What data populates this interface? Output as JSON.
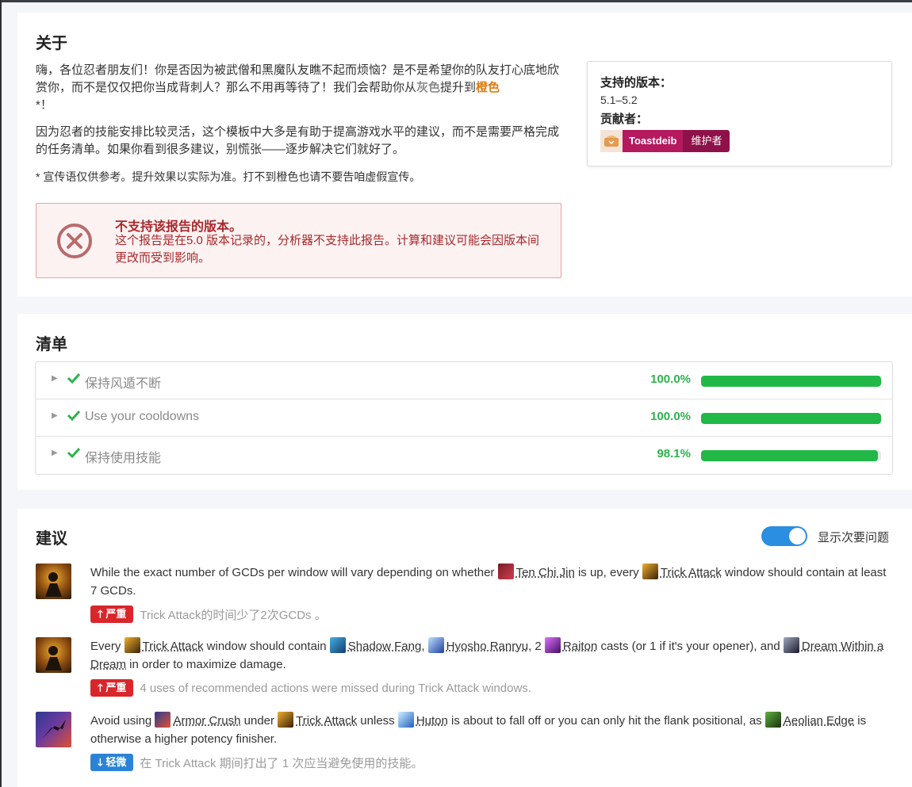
{
  "about": {
    "title": "关于",
    "p1_a": "嗨，各位忍者朋友们！你是否因为被武僧和黑魔队友瞧不起而烦恼？是不是希望你的队友打心底地欣赏你，而不是仅仅把你当成背刺人？那么不用再等待了！我们会帮助你从",
    "p1_gray": "灰色",
    "p1_mid": "提升到",
    "p1_orange": "橙色",
    "p1_end": "*！",
    "p2": "因为忍者的技能安排比较灵活，这个模板中大多是有助于提高游戏水平的建议，而不是需要严格完成的任务清单。如果你看到很多建议，别慌张——逐步解决它们就好了。",
    "p3": "* 宣传语仅供参考。提升效果以实际为准。打不到橙色也请不要告咱虚假宣传。",
    "error_title": "不支持该报告的版本。",
    "error_desc": "这个报告是在5.0 版本记录的，分析器不支持此报告。计算和建议可能会因版本间更改而受到影响。",
    "versions_label": "支持的版本：",
    "versions_value": "5.1–5.2",
    "contributors_label": "贡献者：",
    "contributor_name": "Toastdeib",
    "contributor_role": "维护者"
  },
  "checklist": {
    "title": "清单",
    "items": [
      {
        "label": "保持风遁不断",
        "percent": "100.0%",
        "value": 1.0
      },
      {
        "label": "Use your cooldowns",
        "percent": "100.0%",
        "value": 1.0
      },
      {
        "label": "保持使用技能",
        "percent": "98.1%",
        "value": 0.981
      }
    ]
  },
  "suggestions": {
    "title": "建议",
    "toggle_label": "显示次要问题",
    "toggle_on": true,
    "s1": {
      "t1": "While the exact number of GCDs per window will vary depending on whether ",
      "spell1": "Ten Chi Jin",
      "t2": " is up, every ",
      "spell2": "Trick Attack",
      "t3": " window should contain at least 7 GCDs.",
      "severity": "严重",
      "detail": "Trick Attack的时间少了2次GCDs 。"
    },
    "s2": {
      "t1": "Every ",
      "spell1": "Trick Attack",
      "t2": " window should contain ",
      "spell2": "Shadow Fang",
      "t3": ", ",
      "spell3": "Hyosho Ranryu",
      "t4": ", 2 ",
      "spell4": "Raiton",
      "t5": " casts (or 1 if it's your opener), and ",
      "spell5": "Dream Within a Dream",
      "t6": " in order to maximize damage.",
      "severity": "严重",
      "detail": "4 uses of recommended actions were missed during Trick Attack windows."
    },
    "s3": {
      "t1": "Avoid using ",
      "spell1": "Armor Crush",
      "t2": " under ",
      "spell2": "Trick Attack",
      "t3": " unless ",
      "spell3": "Huton",
      "t4": " is about to fall off or you can only hit the flank positional, as ",
      "spell4": "Aeolian Edge",
      "t5": " is otherwise a higher potency finisher.",
      "severity": "轻微",
      "detail": "在 Trick Attack 期间打出了 1 次应当避免使用的技能。"
    }
  }
}
